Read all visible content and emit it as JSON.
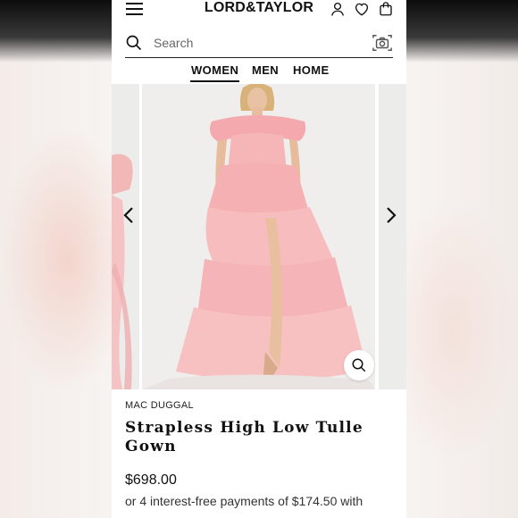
{
  "header": {
    "logo_text": "LORD&TAYLOR",
    "icons": [
      "menu-icon",
      "account-icon",
      "wishlist-heart-icon",
      "shopping-bag-icon"
    ]
  },
  "search": {
    "placeholder": "Search",
    "icons": [
      "search-icon",
      "camera-icon"
    ]
  },
  "nav": {
    "tabs": [
      {
        "label": "WOMEN",
        "active": true
      },
      {
        "label": "MEN",
        "active": false
      },
      {
        "label": "HOME",
        "active": false
      }
    ]
  },
  "gallery": {
    "icons": [
      "chevron-left-icon",
      "chevron-right-icon",
      "zoom-icon"
    ],
    "image_colors": {
      "dress": "#f3b3b6",
      "background": "#efeeec"
    }
  },
  "product": {
    "brand": "MAC DUGGAL",
    "title": "Strapless High Low Tulle Gown",
    "price": "$698.00",
    "installments": "or 4 interest-free payments of $174.50 with"
  },
  "colors": {
    "text": "#111111",
    "page_background": "#ffffff"
  }
}
